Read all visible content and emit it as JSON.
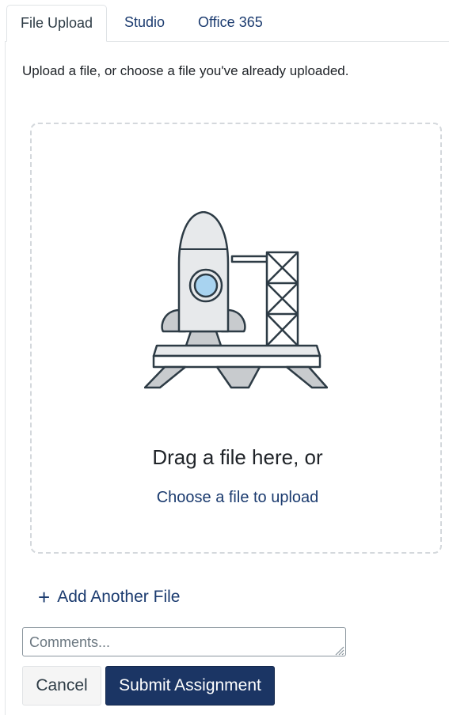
{
  "tabs": [
    {
      "label": "File Upload",
      "active": true
    },
    {
      "label": "Studio",
      "active": false
    },
    {
      "label": "Office 365",
      "active": false
    }
  ],
  "intro_text": "Upload a file, or choose a file you've already uploaded.",
  "dropzone": {
    "illustration_icon": "rocket-launchpad-icon",
    "drag_text": "Drag a file here, or",
    "choose_link": "Choose a file to upload"
  },
  "add_file": {
    "icon": "plus-icon",
    "label": "Add Another File"
  },
  "comments": {
    "placeholder": "Comments...",
    "value": ""
  },
  "actions": {
    "cancel_label": "Cancel",
    "submit_label": "Submit Assignment"
  },
  "colors": {
    "link": "#1b3b6f",
    "primary_button": "#1b3564",
    "dropzone_border": "#d4d8dc"
  }
}
